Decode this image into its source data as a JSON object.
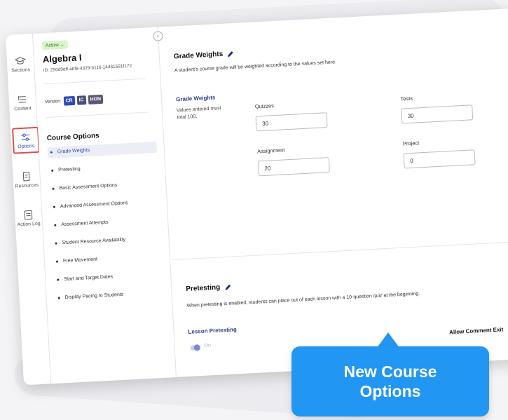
{
  "rail": {
    "items": [
      {
        "label": "Sections",
        "icon": "graduation-cap-icon"
      },
      {
        "label": "Content",
        "icon": "list-icon"
      },
      {
        "label": "Options",
        "icon": "sliders-icon"
      },
      {
        "label": "Resources",
        "icon": "document-icon"
      },
      {
        "label": "Action Log",
        "icon": "log-icon"
      }
    ]
  },
  "course": {
    "status": "Active",
    "title": "Algebra I",
    "id": "ID: 256d9eff-abf8-4329-b116-14461591f172",
    "version_label": "Version:",
    "versions": [
      {
        "label": "CR",
        "color": "#2d4bb9"
      },
      {
        "label": "IC",
        "color": "#4a4f7a"
      },
      {
        "label": "HON",
        "color": "#5a5670"
      }
    ]
  },
  "options": {
    "title": "Course Options",
    "items": [
      "Grade Weights",
      "Pretesting",
      "Basic Assessment Options",
      "Advanced Assessment Options",
      "Assessment Attempts",
      "Student Resource Availability",
      "Free Movement",
      "Start and Target Dates",
      "Display Pacing to Students"
    ]
  },
  "grade_weights": {
    "title": "Grade Weights",
    "description": "A student's course grade will be weighted according to the values set here.",
    "subtitle": "Grade Weights",
    "note": "Values entered must total 100.",
    "fields": [
      {
        "label": "Quizzes",
        "value": "30"
      },
      {
        "label": "Tests",
        "value": "30"
      },
      {
        "label": "Assignment",
        "value": "20"
      },
      {
        "label": "Project",
        "value": "0"
      }
    ]
  },
  "pretesting": {
    "title": "Pretesting",
    "description": "When pretesting is enabled, students can place out of each lesson with a 10-question quiz at the beginning.",
    "subtitle": "Lesson Pretesting",
    "toggle_label": "On",
    "allow_text": "Allow Comment Exit"
  },
  "callout": {
    "line1": "New Course",
    "line2": "Options"
  },
  "colors": {
    "accent": "#2d4bb9",
    "callout": "#2196f3",
    "highlight": "#e04c4c"
  }
}
